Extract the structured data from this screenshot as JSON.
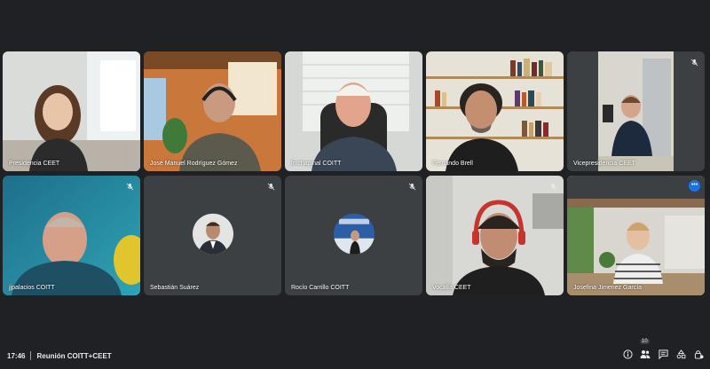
{
  "participants": [
    {
      "name": "Presidencia CEET"
    },
    {
      "name": "José Manuel Rodríguez Gómez"
    },
    {
      "name": "lmchapinal COITT"
    },
    {
      "name": "Fernando Brell"
    },
    {
      "name": "Vicepresidencia CEET"
    },
    {
      "name": "jjpalacios COITT"
    },
    {
      "name": "Sebastián Suárez"
    },
    {
      "name": "Rocío Carrillo COITT"
    },
    {
      "name": "Vocalía CEET"
    },
    {
      "name": "Josefina Jimenez García"
    }
  ],
  "bottombar": {
    "time": "17:46",
    "meeting_name": "Reunión COITT+CEET",
    "people_count": "10"
  },
  "colors": {
    "background": "#202124",
    "tile": "#3c4043",
    "active_outline": "#8ab4f8",
    "accent": "#1a73e8"
  },
  "icons": {
    "mute": "mic-off-icon",
    "more": "more-options-icon",
    "info": "info-icon",
    "people": "people-icon",
    "chat": "chat-icon",
    "activities": "activities-icon",
    "host": "host-controls-icon"
  }
}
